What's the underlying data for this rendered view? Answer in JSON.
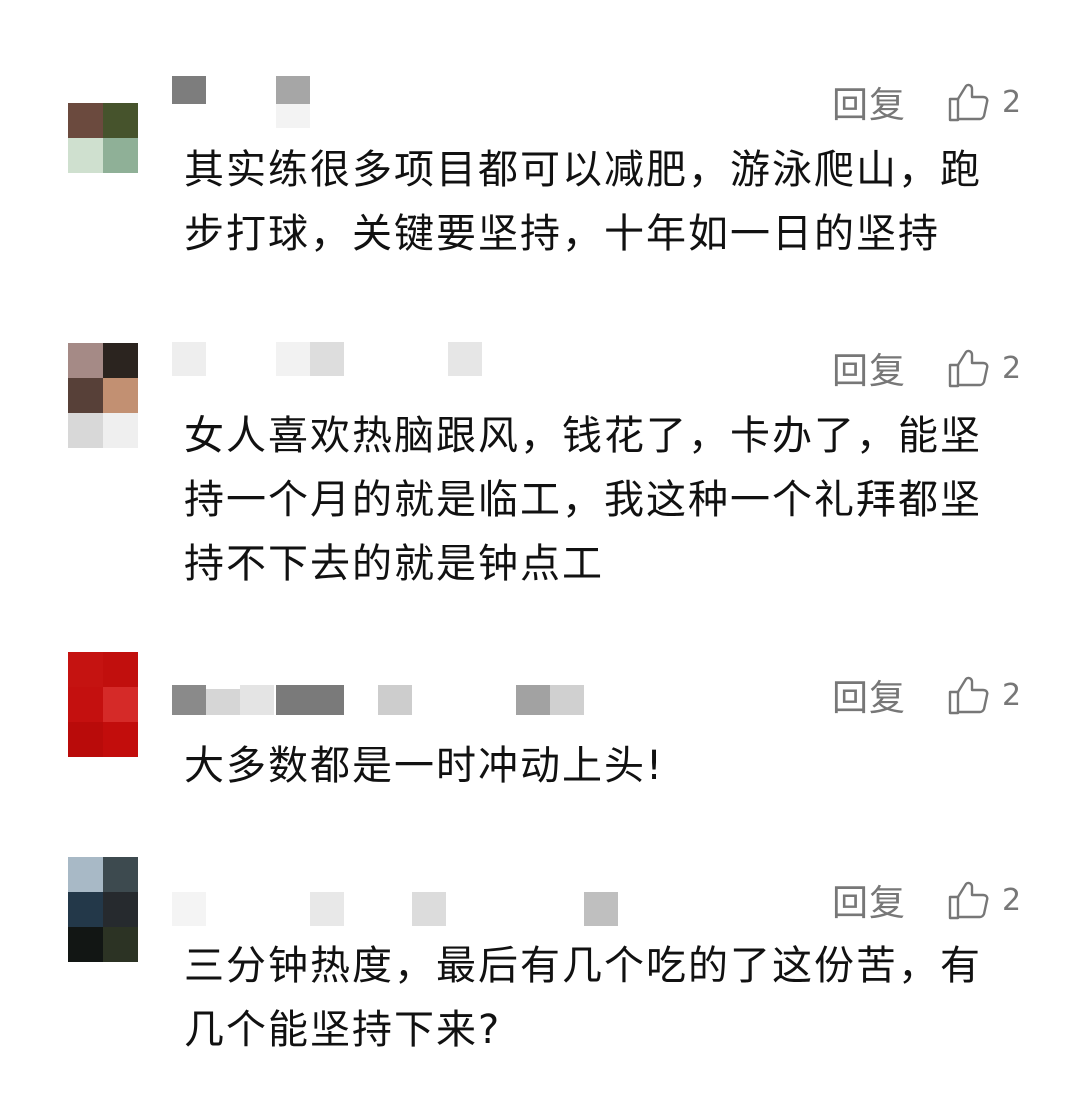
{
  "comments": [
    {
      "reply_label": "回复",
      "like_count": "2",
      "text": "其实练很多项目都可以减肥，游泳爬山，跑\n步打球，关键要坚持，十年如一日的坚持",
      "avatar_colors": [
        "#6b4a3e",
        "#46532c",
        "#cfe0cf",
        "#8fb097"
      ]
    },
    {
      "reply_label": "回复",
      "like_count": "2",
      "text": "女人喜欢热脑跟风，钱花了，卡办了，能坚\n持一个月的就是临工，我这种一个礼拜都坚\n持不下去的就是钟点工",
      "avatar_colors": [
        "#a58a86",
        "#2b241f",
        "#574038",
        "#c29072",
        "#d8d8d8",
        "#efefef"
      ]
    },
    {
      "reply_label": "回复",
      "like_count": "2",
      "text": "大多数都是一时冲动上头!",
      "avatar_colors": [
        "#c51311",
        "#c10f0d",
        "#c4100f",
        "#d52a28",
        "#b90b0a",
        "#c20d0c"
      ]
    },
    {
      "reply_label": "回复",
      "like_count": "2",
      "text": "三分钟热度，最后有几个吃的了这份苦，有\n几个能坚持下来?",
      "avatar_colors": [
        "#a8b9c6",
        "#3d4a4f",
        "#233849",
        "#262a2e",
        "#121614",
        "#2c3324"
      ]
    }
  ]
}
